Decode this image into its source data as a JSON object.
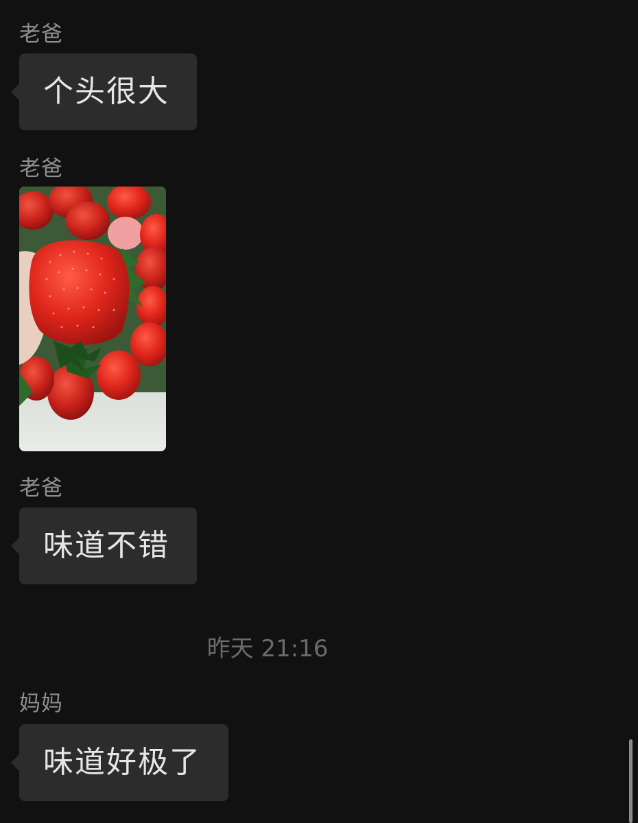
{
  "messages": [
    {
      "sender": "老爸",
      "text": "个头很大"
    },
    {
      "sender": "老爸",
      "image_alt": "strawberries photo"
    },
    {
      "sender": "老爸",
      "text": "味道不错"
    },
    {
      "sender": "妈妈",
      "text": "味道好极了"
    }
  ],
  "timestamp": "昨天 21:16",
  "colors": {
    "background": "#111111",
    "bubble": "#2c2c2c",
    "sender_text": "#8f8f8f",
    "message_text": "#e6e6e6",
    "timestamp_text": "#6b6b6b"
  }
}
